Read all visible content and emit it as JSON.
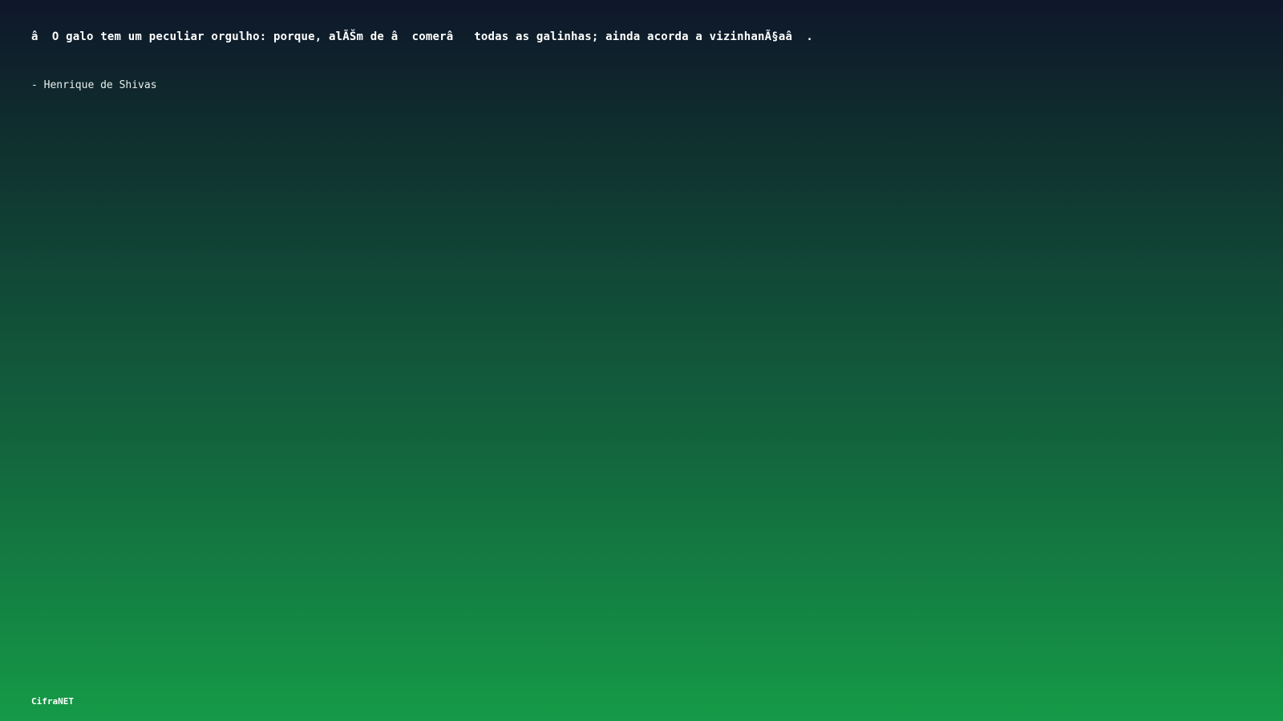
{
  "quote": {
    "text": "â  O galo tem um peculiar orgulho: porque, alÃŠm de â  comerâ   todas as galinhas; ainda acorda a vizinhanÃ§aâ  .",
    "author": "- Henrique de Shivas"
  },
  "footer": {
    "brand": "CifraNET"
  },
  "colors": {
    "background_top": "#0f172a",
    "background_bottom": "#159a47",
    "text": "#ffffff"
  }
}
